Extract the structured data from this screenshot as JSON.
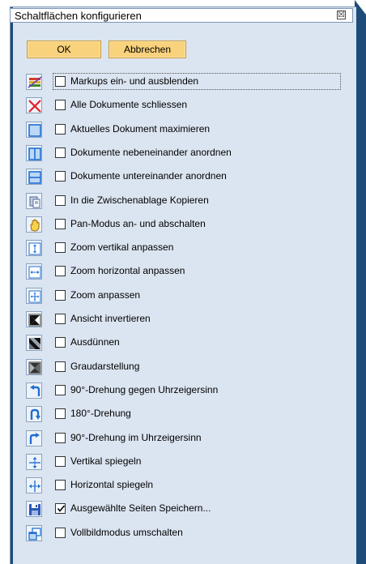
{
  "dialog": {
    "title": "Schaltflächen konfigurieren",
    "close_glyph": "☒"
  },
  "buttons": {
    "ok_label": "OK",
    "cancel_label": "Abbrechen"
  },
  "items": [
    {
      "icon": "layers-icon",
      "label": "Markups ein- und ausblenden",
      "checked": false,
      "focused": true
    },
    {
      "icon": "close-x-icon",
      "label": "Alle Dokumente schliessen",
      "checked": false
    },
    {
      "icon": "maximize-icon",
      "label": "Aktuelles Dokument maximieren",
      "checked": false
    },
    {
      "icon": "tile-vertical-icon",
      "label": "Dokumente nebeneinander anordnen",
      "checked": false
    },
    {
      "icon": "tile-horizontal-icon",
      "label": "Dokumente untereinander anordnen",
      "checked": false
    },
    {
      "icon": "copy-clipboard-icon",
      "label": "In die Zwischenablage Kopieren",
      "checked": false
    },
    {
      "icon": "pan-hand-icon",
      "label": "Pan-Modus an- und abschalten",
      "checked": false
    },
    {
      "icon": "zoom-vertical-icon",
      "label": "Zoom vertikal anpassen",
      "checked": false
    },
    {
      "icon": "zoom-horizontal-icon",
      "label": "Zoom horizontal anpassen",
      "checked": false
    },
    {
      "icon": "zoom-fit-icon",
      "label": "Zoom anpassen",
      "checked": false
    },
    {
      "icon": "invert-view-icon",
      "label": "Ansicht invertieren",
      "checked": false
    },
    {
      "icon": "thin-out-icon",
      "label": "Ausdünnen",
      "checked": false
    },
    {
      "icon": "grayscale-icon",
      "label": "Graudarstellung",
      "checked": false
    },
    {
      "icon": "rotate-ccw-icon",
      "label": "90°-Drehung gegen Uhrzeigersinn",
      "checked": false
    },
    {
      "icon": "rotate-180-icon",
      "label": "180°-Drehung",
      "checked": false
    },
    {
      "icon": "rotate-cw-icon",
      "label": "90°-Drehung im Uhrzeigersinn",
      "checked": false
    },
    {
      "icon": "flip-vertical-icon",
      "label": "Vertikal spiegeln",
      "checked": false
    },
    {
      "icon": "flip-horizontal-icon",
      "label": "Horizontal spiegeln",
      "checked": false
    },
    {
      "icon": "save-pages-icon",
      "label": "Ausgewählte Seiten Speichern...",
      "checked": true
    },
    {
      "icon": "fullscreen-icon",
      "label": "Vollbildmodus umschalten",
      "checked": false
    }
  ],
  "colors": {
    "panel_bg": "#dbe5f1",
    "button_bg": "#f9d27c",
    "accent_blue": "#1f6fd1",
    "close_red": "#e0202a"
  }
}
